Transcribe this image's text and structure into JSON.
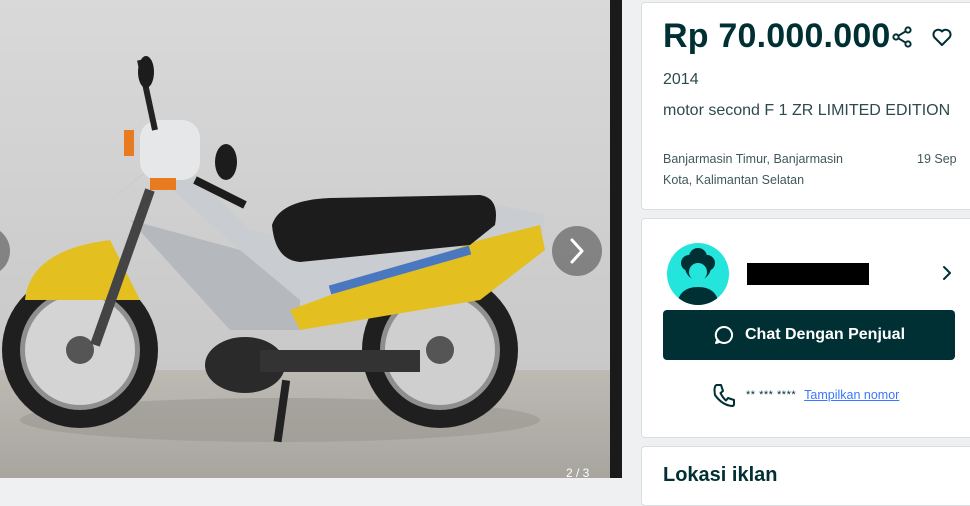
{
  "listing": {
    "price": "Rp 70.000.000",
    "year": "2014",
    "title": "motor second F 1 ZR LIMITED EDITION",
    "location": "Banjarmasin Timur, Banjarmasin Kota, Kalimantan Selatan",
    "date": "19 Sep"
  },
  "gallery": {
    "counter": "2 / 3",
    "image": "photo of yellow and silver scooter motorcycle against white textured wall"
  },
  "seller": {
    "chat_label": "Chat Dengan Penjual",
    "phone_masked": "** *** ****",
    "show_number_label": "Tampilkan nomor"
  },
  "section": {
    "location_title": "Lokasi iklan"
  },
  "icons": {
    "share": "share-icon",
    "favorite": "heart-icon",
    "next": "chevron-right-icon",
    "seller_link": "chevron-right-icon",
    "chat": "chat-bubble-icon",
    "phone": "phone-icon"
  },
  "colors": {
    "primary_dark": "#002f34",
    "avatar_bg": "#23e5db",
    "link": "#3a77ff"
  }
}
